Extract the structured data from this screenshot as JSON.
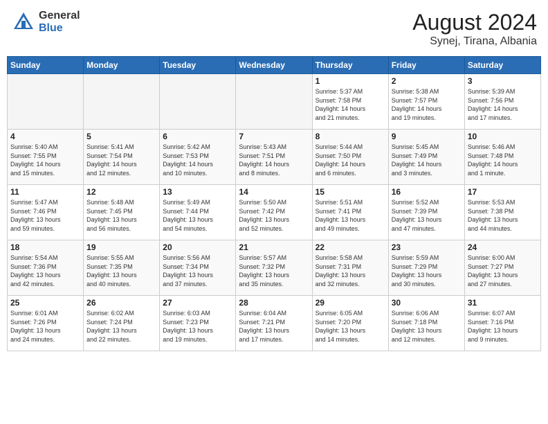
{
  "header": {
    "logo_general": "General",
    "logo_blue": "Blue",
    "month_title": "August 2024",
    "location": "Synej, Tirana, Albania"
  },
  "weekdays": [
    "Sunday",
    "Monday",
    "Tuesday",
    "Wednesday",
    "Thursday",
    "Friday",
    "Saturday"
  ],
  "weeks": [
    [
      {
        "day": "",
        "info": ""
      },
      {
        "day": "",
        "info": ""
      },
      {
        "day": "",
        "info": ""
      },
      {
        "day": "",
        "info": ""
      },
      {
        "day": "1",
        "info": "Sunrise: 5:37 AM\nSunset: 7:58 PM\nDaylight: 14 hours\nand 21 minutes."
      },
      {
        "day": "2",
        "info": "Sunrise: 5:38 AM\nSunset: 7:57 PM\nDaylight: 14 hours\nand 19 minutes."
      },
      {
        "day": "3",
        "info": "Sunrise: 5:39 AM\nSunset: 7:56 PM\nDaylight: 14 hours\nand 17 minutes."
      }
    ],
    [
      {
        "day": "4",
        "info": "Sunrise: 5:40 AM\nSunset: 7:55 PM\nDaylight: 14 hours\nand 15 minutes."
      },
      {
        "day": "5",
        "info": "Sunrise: 5:41 AM\nSunset: 7:54 PM\nDaylight: 14 hours\nand 12 minutes."
      },
      {
        "day": "6",
        "info": "Sunrise: 5:42 AM\nSunset: 7:53 PM\nDaylight: 14 hours\nand 10 minutes."
      },
      {
        "day": "7",
        "info": "Sunrise: 5:43 AM\nSunset: 7:51 PM\nDaylight: 14 hours\nand 8 minutes."
      },
      {
        "day": "8",
        "info": "Sunrise: 5:44 AM\nSunset: 7:50 PM\nDaylight: 14 hours\nand 6 minutes."
      },
      {
        "day": "9",
        "info": "Sunrise: 5:45 AM\nSunset: 7:49 PM\nDaylight: 14 hours\nand 3 minutes."
      },
      {
        "day": "10",
        "info": "Sunrise: 5:46 AM\nSunset: 7:48 PM\nDaylight: 14 hours\nand 1 minute."
      }
    ],
    [
      {
        "day": "11",
        "info": "Sunrise: 5:47 AM\nSunset: 7:46 PM\nDaylight: 13 hours\nand 59 minutes."
      },
      {
        "day": "12",
        "info": "Sunrise: 5:48 AM\nSunset: 7:45 PM\nDaylight: 13 hours\nand 56 minutes."
      },
      {
        "day": "13",
        "info": "Sunrise: 5:49 AM\nSunset: 7:44 PM\nDaylight: 13 hours\nand 54 minutes."
      },
      {
        "day": "14",
        "info": "Sunrise: 5:50 AM\nSunset: 7:42 PM\nDaylight: 13 hours\nand 52 minutes."
      },
      {
        "day": "15",
        "info": "Sunrise: 5:51 AM\nSunset: 7:41 PM\nDaylight: 13 hours\nand 49 minutes."
      },
      {
        "day": "16",
        "info": "Sunrise: 5:52 AM\nSunset: 7:39 PM\nDaylight: 13 hours\nand 47 minutes."
      },
      {
        "day": "17",
        "info": "Sunrise: 5:53 AM\nSunset: 7:38 PM\nDaylight: 13 hours\nand 44 minutes."
      }
    ],
    [
      {
        "day": "18",
        "info": "Sunrise: 5:54 AM\nSunset: 7:36 PM\nDaylight: 13 hours\nand 42 minutes."
      },
      {
        "day": "19",
        "info": "Sunrise: 5:55 AM\nSunset: 7:35 PM\nDaylight: 13 hours\nand 40 minutes."
      },
      {
        "day": "20",
        "info": "Sunrise: 5:56 AM\nSunset: 7:34 PM\nDaylight: 13 hours\nand 37 minutes."
      },
      {
        "day": "21",
        "info": "Sunrise: 5:57 AM\nSunset: 7:32 PM\nDaylight: 13 hours\nand 35 minutes."
      },
      {
        "day": "22",
        "info": "Sunrise: 5:58 AM\nSunset: 7:31 PM\nDaylight: 13 hours\nand 32 minutes."
      },
      {
        "day": "23",
        "info": "Sunrise: 5:59 AM\nSunset: 7:29 PM\nDaylight: 13 hours\nand 30 minutes."
      },
      {
        "day": "24",
        "info": "Sunrise: 6:00 AM\nSunset: 7:27 PM\nDaylight: 13 hours\nand 27 minutes."
      }
    ],
    [
      {
        "day": "25",
        "info": "Sunrise: 6:01 AM\nSunset: 7:26 PM\nDaylight: 13 hours\nand 24 minutes."
      },
      {
        "day": "26",
        "info": "Sunrise: 6:02 AM\nSunset: 7:24 PM\nDaylight: 13 hours\nand 22 minutes."
      },
      {
        "day": "27",
        "info": "Sunrise: 6:03 AM\nSunset: 7:23 PM\nDaylight: 13 hours\nand 19 minutes."
      },
      {
        "day": "28",
        "info": "Sunrise: 6:04 AM\nSunset: 7:21 PM\nDaylight: 13 hours\nand 17 minutes."
      },
      {
        "day": "29",
        "info": "Sunrise: 6:05 AM\nSunset: 7:20 PM\nDaylight: 13 hours\nand 14 minutes."
      },
      {
        "day": "30",
        "info": "Sunrise: 6:06 AM\nSunset: 7:18 PM\nDaylight: 13 hours\nand 12 minutes."
      },
      {
        "day": "31",
        "info": "Sunrise: 6:07 AM\nSunset: 7:16 PM\nDaylight: 13 hours\nand 9 minutes."
      }
    ]
  ]
}
